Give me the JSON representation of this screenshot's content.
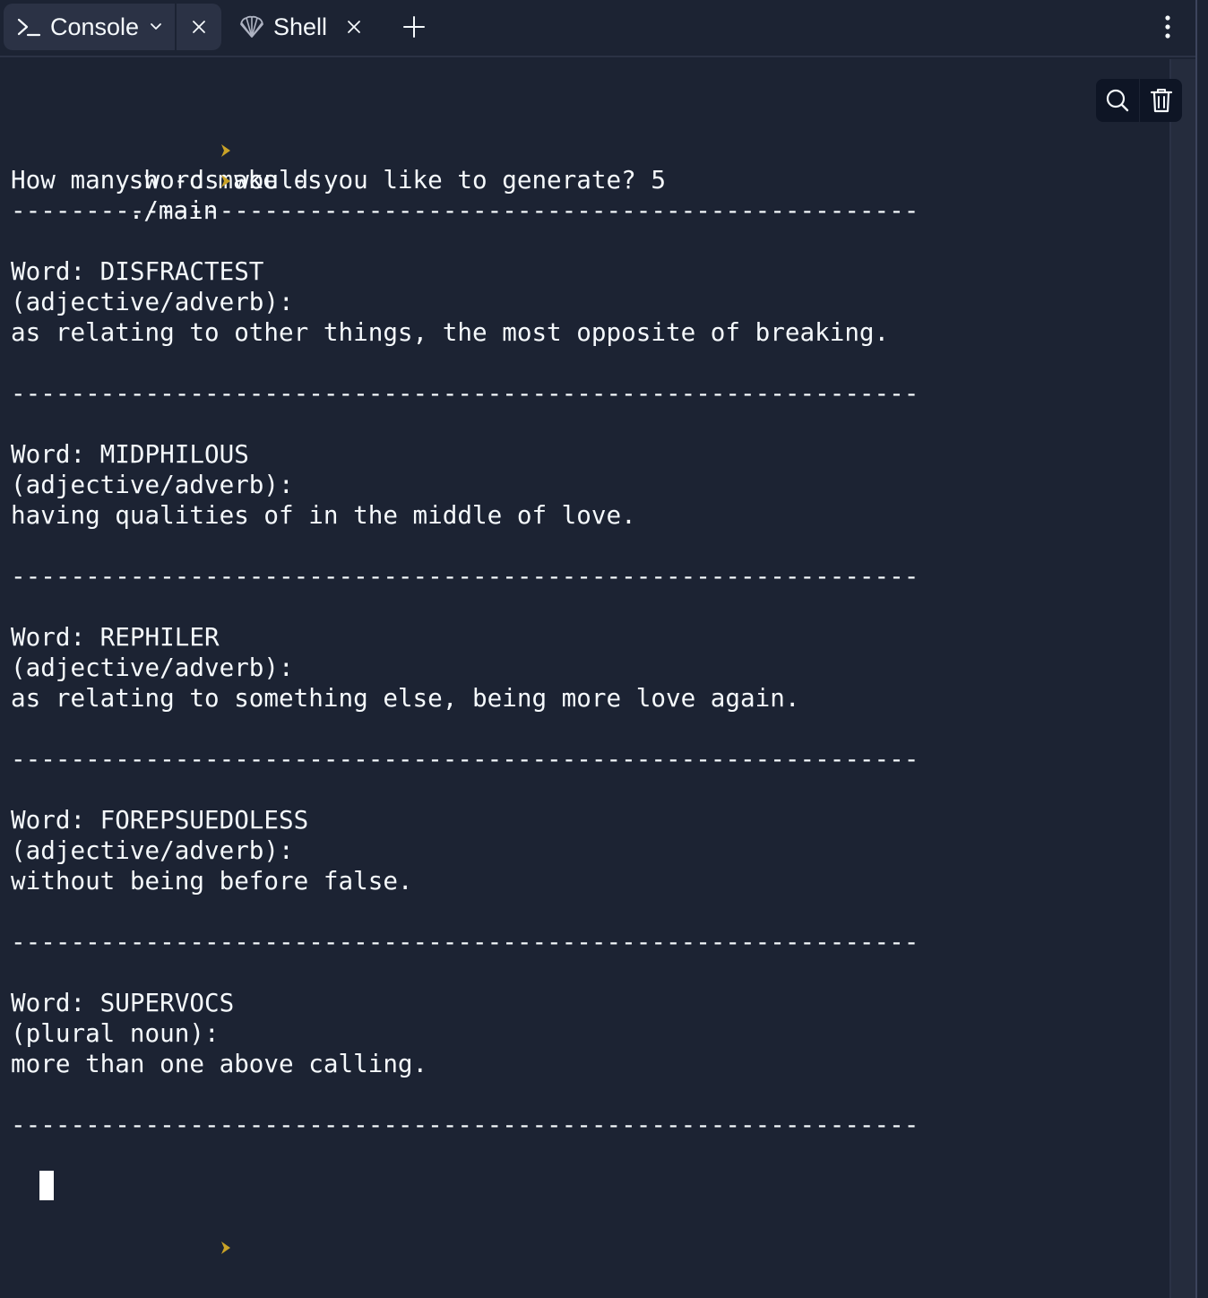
{
  "tabs": {
    "console": {
      "label": "Console"
    },
    "shell": {
      "label": "Shell"
    }
  },
  "terminal": {
    "commands": [
      "sh -c make -s",
      "./main"
    ],
    "question": "How many words would you like to generate? 5",
    "separator": "-------------------------------------------------------------",
    "entries": [
      {
        "word": "Word: DISFRACTEST",
        "pos": "(adjective/adverb):",
        "definition": "as relating to other things, the most opposite of breaking."
      },
      {
        "word": "Word: MIDPHILOUS",
        "pos": "(adjective/adverb):",
        "definition": "having qualities of in the middle of love."
      },
      {
        "word": "Word: REPHILER",
        "pos": "(adjective/adverb):",
        "definition": "as relating to something else, being more love again."
      },
      {
        "word": "Word: FOREPSUEDOLESS",
        "pos": "(adjective/adverb):",
        "definition": "without being before false."
      },
      {
        "word": "Word: SUPERVOCS",
        "pos": "(plural noun):",
        "definition": "more than one above calling."
      }
    ]
  },
  "icons": {
    "console_tab": "terminal-prompt-icon",
    "console_dropdown": "chevron-down-icon",
    "console_close": "close-icon",
    "shell_tab": "shell-icon",
    "shell_close": "close-icon",
    "add_tab": "plus-icon",
    "more": "more-vertical-icon",
    "search": "search-icon",
    "clear": "trash-icon",
    "prompt": "prompt-chevron-icon"
  },
  "colors": {
    "background": "#1c2333",
    "tab_active": "#2b3245",
    "text": "#f5f9fc",
    "prompt": "#c9a227",
    "action_bg": "#0e1525"
  }
}
